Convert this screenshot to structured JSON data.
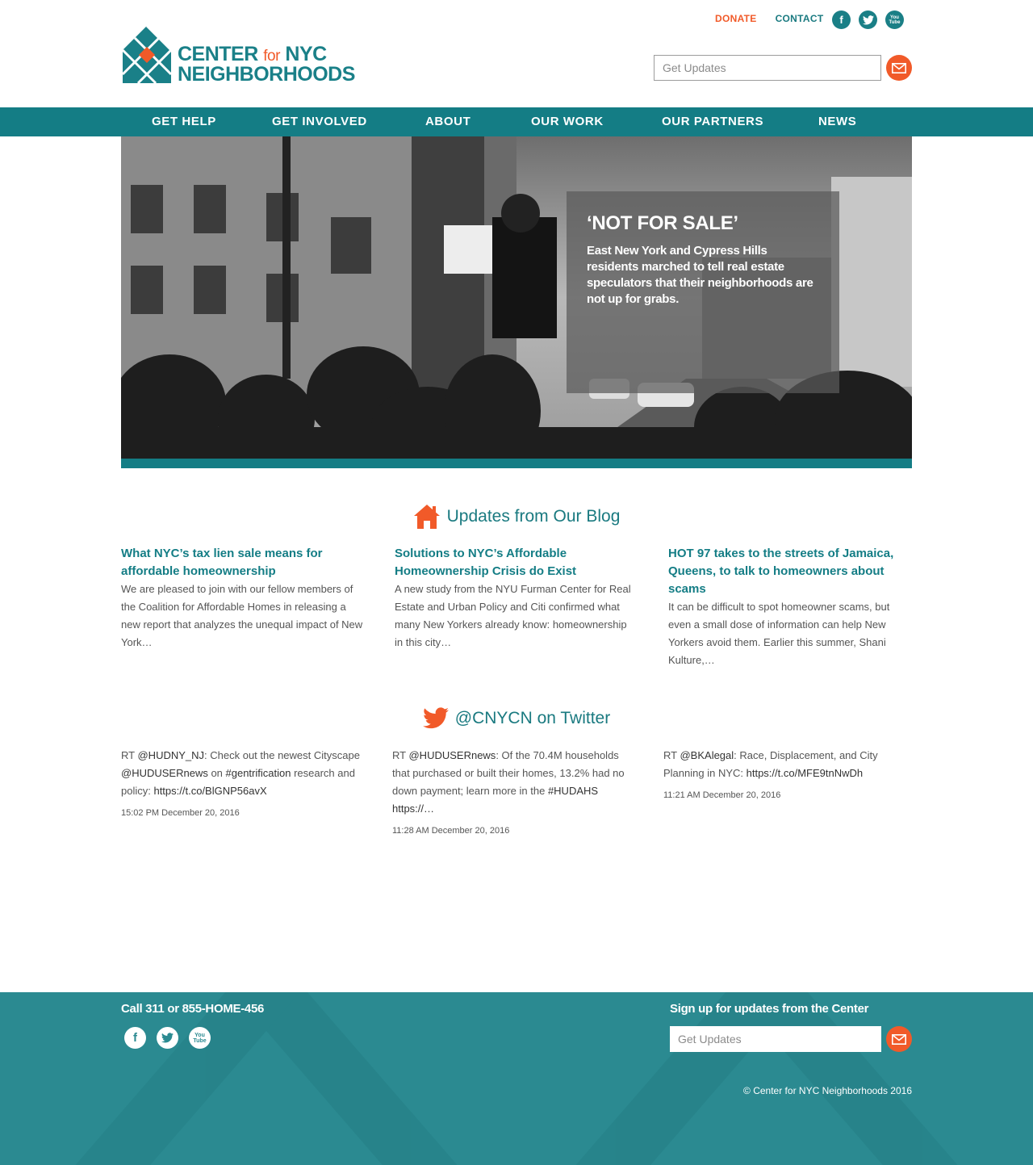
{
  "header": {
    "logo": {
      "line1_a": "CENTER",
      "line1_for": "for",
      "line1_b": "NYC",
      "line2": "NEIGHBORHOODS"
    },
    "links": {
      "donate": "DONATE",
      "contact": "CONTACT"
    },
    "social": {
      "facebook": "f",
      "twitter": "t",
      "youtube_a": "You",
      "youtube_b": "Tube"
    },
    "updates_placeholder": "Get Updates"
  },
  "nav": {
    "items": [
      "GET HELP",
      "GET INVOLVED",
      "ABOUT",
      "OUR WORK",
      "OUR PARTNERS",
      "NEWS"
    ]
  },
  "hero": {
    "title": "‘NOT FOR SALE’",
    "text": "East New York and Cypress Hills residents marched to tell real estate speculators that their neighborhoods are not up for grabs."
  },
  "blog": {
    "heading": "Updates from Our Blog",
    "posts": [
      {
        "title": "What NYC’s tax lien sale means for affordable homeownership",
        "excerpt": "We are pleased to join with our fellow members of the Coalition for Affordable Homes in releasing a new report that analyzes the unequal impact of New York…"
      },
      {
        "title": "Solutions to NYC’s Affordable Homeownership Crisis do Exist",
        "excerpt": "A new study from the NYU Furman Center for Real Estate and Urban Policy and Citi confirmed what many New Yorkers already know: homeownership in this city…"
      },
      {
        "title": "HOT 97 takes to the streets of Jamaica, Queens, to talk to homeowners about scams",
        "excerpt": "It can be difficult to spot homeowner scams, but even a small dose of information can help New Yorkers avoid them. Earlier this summer, Shani Kulture,…"
      }
    ]
  },
  "twitter": {
    "heading": "@CNYCN on Twitter",
    "tweets": [
      {
        "prefix": "RT ",
        "handle": "@HUDNY_NJ",
        "text1": ": Check out the newest Cityscape ",
        "mention": "@HUDUSERnews",
        "text2": " on ",
        "hashtag": "#gentrification",
        "text3": " research and policy: ",
        "link": "https://t.co/BlGNP56avX",
        "time": "15:02 PM December 20, 2016"
      },
      {
        "prefix": "RT ",
        "handle": "@HUDUSERnews",
        "text1": ": Of the 70.4M households that purchased or built their homes, 13.2% had no down payment; learn more in the ",
        "mention": "",
        "text2": "",
        "hashtag": "#HUDAHS",
        "text3": " ",
        "link": "https://…",
        "time": "11:28 AM December 20, 2016"
      },
      {
        "prefix": "RT ",
        "handle": "@BKAlegal",
        "text1": ": Race, Displacement, and City Planning in NYC: ",
        "mention": "",
        "text2": "",
        "hashtag": "",
        "text3": "",
        "link": "https://t.co/MFE9tnNwDh",
        "time": "11:21 AM December 20, 2016"
      }
    ]
  },
  "footer": {
    "call": "Call 311 or 855-HOME-456",
    "signup": "Sign up for updates from the Center",
    "updates_placeholder": "Get Updates",
    "copyright": "© Center for NYC Neighborhoods 2016"
  },
  "colors": {
    "teal": "#147d85",
    "orange": "#f15a29",
    "footer": "#2b8a91"
  }
}
